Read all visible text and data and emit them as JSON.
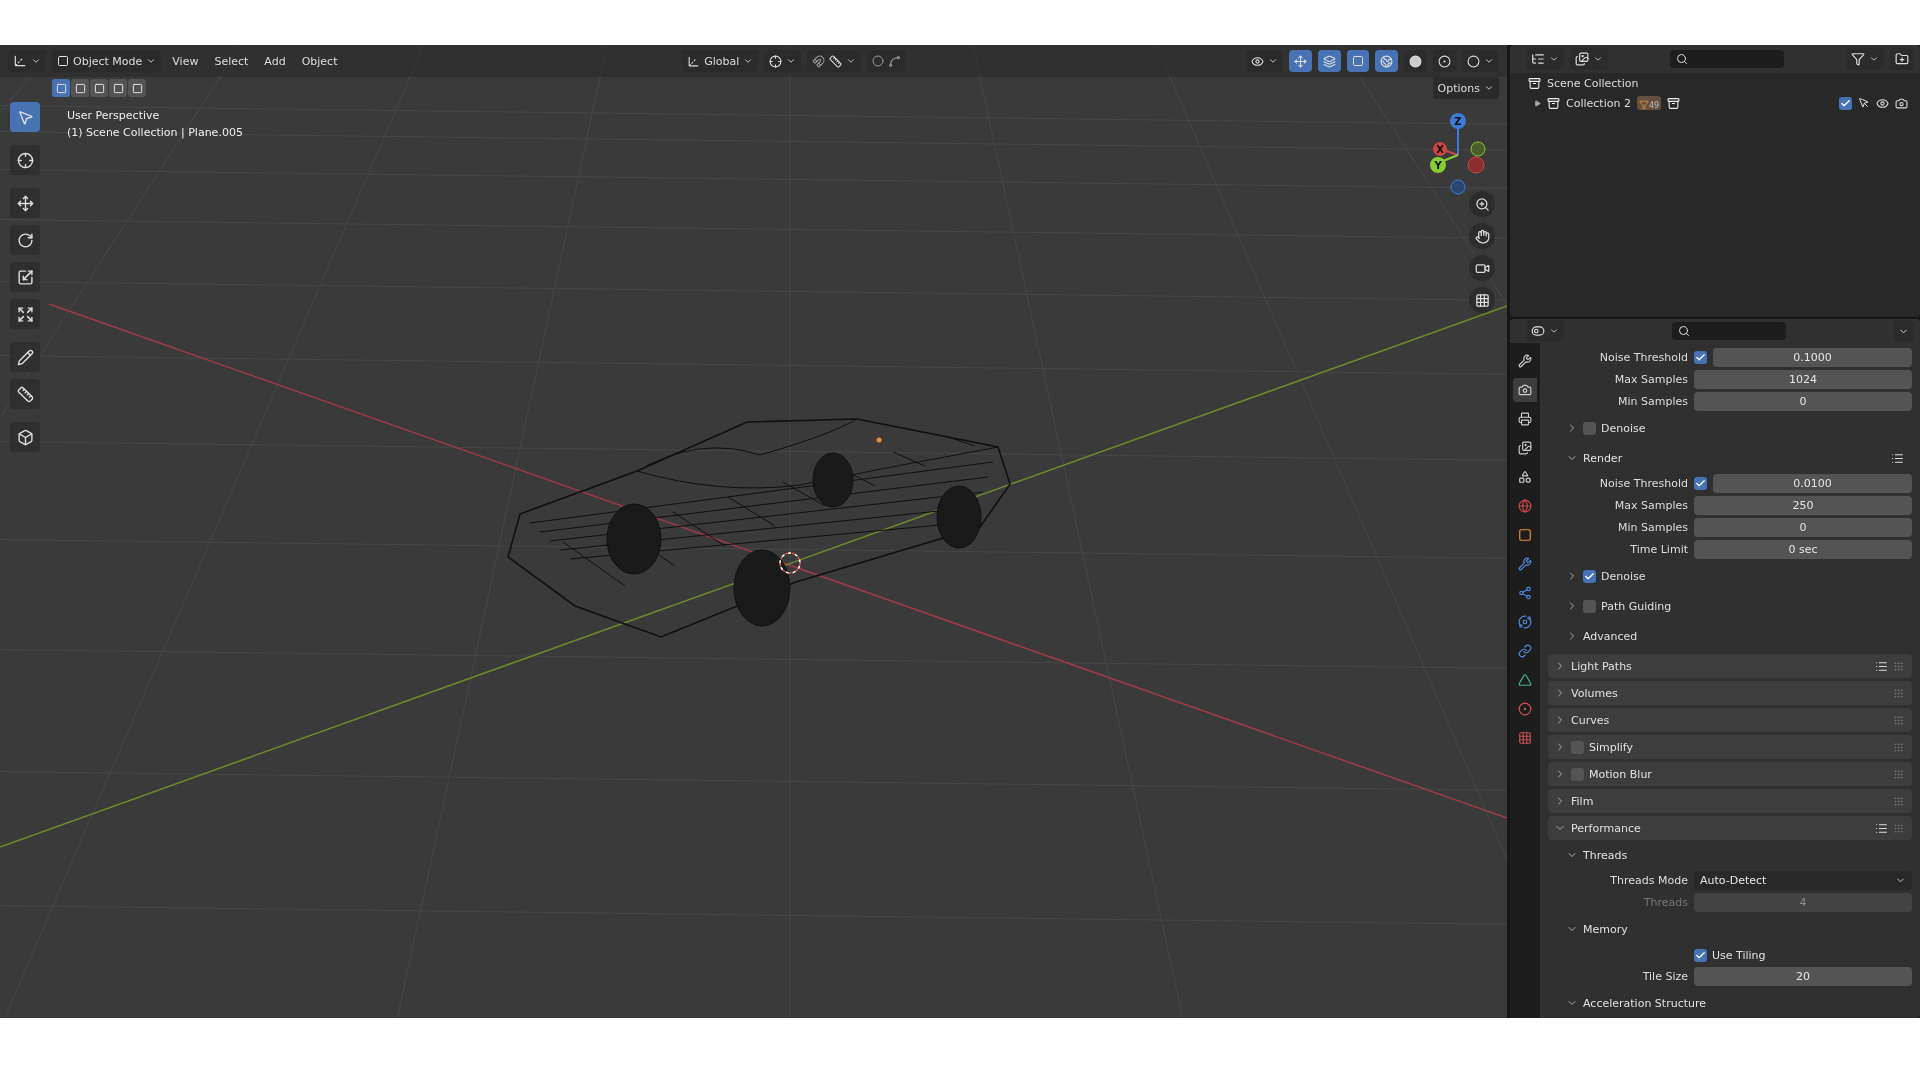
{
  "header": {
    "mode": "Object Mode",
    "menus": [
      "View",
      "Select",
      "Add",
      "Object"
    ],
    "orientation": "Global",
    "options": "Options"
  },
  "select_modes": [
    {
      "selected": true
    },
    {
      "selected": false
    },
    {
      "selected": false
    },
    {
      "selected": false
    },
    {
      "selected": false
    }
  ],
  "toolbar": [
    {
      "selected": true
    },
    {
      "selected": false
    },
    {
      "selected": false
    },
    {
      "selected": false
    },
    {
      "selected": false
    },
    {
      "selected": false
    },
    {
      "selected": false
    },
    {
      "selected": false
    },
    {
      "selected": false
    }
  ],
  "viewport": {
    "view_name": "User Perspective",
    "context": "(1) Scene Collection | Plane.005",
    "gizmo_axes": [
      "X",
      "Y",
      "Z"
    ]
  },
  "outliner": {
    "items": [
      {
        "label": "Scene Collection",
        "children": [
          {
            "label": "Collection 2",
            "expanded": false,
            "badge": "49",
            "checked": true
          }
        ]
      }
    ]
  },
  "properties": {
    "tabs": [
      {
        "selected": false
      },
      {
        "selected": true
      },
      {
        "selected": false
      },
      {
        "selected": false
      },
      {
        "selected": false
      },
      {
        "selected": false
      },
      {
        "selected": false
      },
      {
        "selected": false
      },
      {
        "selected": false
      },
      {
        "selected": false
      },
      {
        "selected": false
      },
      {
        "selected": false
      },
      {
        "selected": false
      },
      {
        "selected": false
      }
    ],
    "rows": [
      {
        "kind": "field",
        "label": "Noise Threshold",
        "checked": true,
        "value": "0.1000",
        "disabled": false
      },
      {
        "kind": "field",
        "label": "Max Samples",
        "value": "1024",
        "disabled": false
      },
      {
        "kind": "field",
        "label": "Min Samples",
        "value": "0",
        "disabled": false
      },
      {
        "kind": "subpanel",
        "label": "Denoise",
        "expanded": false,
        "checked": false
      },
      {
        "kind": "subpanel",
        "label": "Render",
        "expanded": true,
        "presets": true
      },
      {
        "kind": "field",
        "label": "Noise Threshold",
        "checked": true,
        "value": "0.0100",
        "disabled": false
      },
      {
        "kind": "field",
        "label": "Max Samples",
        "value": "250",
        "disabled": false
      },
      {
        "kind": "field",
        "label": "Min Samples",
        "value": "0",
        "disabled": false
      },
      {
        "kind": "field",
        "label": "Time Limit",
        "value": "0 sec",
        "disabled": false
      },
      {
        "kind": "subpanel",
        "label": "Denoise",
        "expanded": false,
        "checked": true
      },
      {
        "kind": "subpanel",
        "label": "Path Guiding",
        "expanded": false,
        "checked": false
      },
      {
        "kind": "subpanel",
        "label": "Advanced",
        "expanded": false
      },
      {
        "kind": "panel",
        "label": "Light Paths",
        "expanded": false,
        "presets": true
      },
      {
        "kind": "panel",
        "label": "Volumes",
        "expanded": false
      },
      {
        "kind": "panel",
        "label": "Curves",
        "expanded": false
      },
      {
        "kind": "panel",
        "label": "Simplify",
        "expanded": false,
        "checked": false
      },
      {
        "kind": "panel",
        "label": "Motion Blur",
        "expanded": false,
        "checked": false
      },
      {
        "kind": "panel",
        "label": "Film",
        "expanded": false
      },
      {
        "kind": "panel",
        "label": "Performance",
        "expanded": true,
        "presets": true
      },
      {
        "kind": "subpanel",
        "label": "Threads",
        "expanded": true
      },
      {
        "kind": "dropdown",
        "label": "Threads Mode",
        "value": "Auto-Detect"
      },
      {
        "kind": "field",
        "label": "Threads",
        "value": "4",
        "disabled": true
      },
      {
        "kind": "subpanel",
        "label": "Memory",
        "expanded": true
      },
      {
        "kind": "check",
        "label": "Use Tiling",
        "checked": true
      },
      {
        "kind": "field",
        "label": "Tile Size",
        "value": "20",
        "disabled": false
      },
      {
        "kind": "subpanel",
        "label": "Acceleration Structure",
        "expanded": true
      }
    ]
  }
}
